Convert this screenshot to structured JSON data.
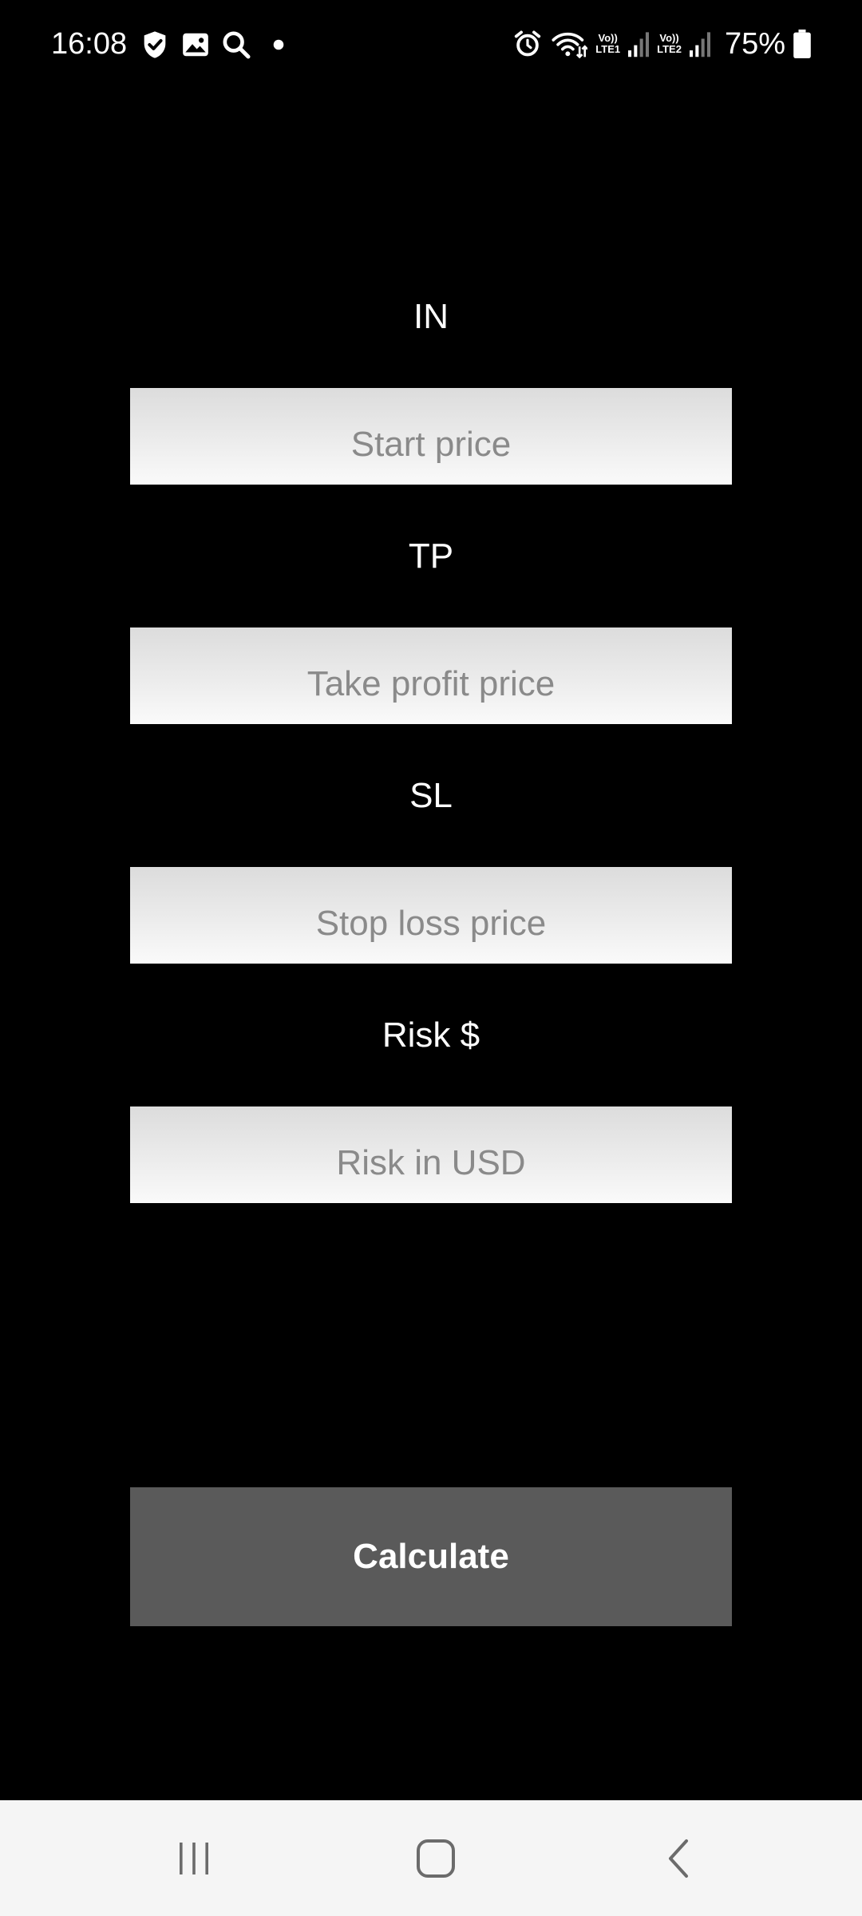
{
  "status_bar": {
    "time": "16:08",
    "left_icons": [
      "shield-check-icon",
      "gallery-icon",
      "search-icon",
      "dot-icon"
    ],
    "right_icons": [
      "alarm-icon",
      "wifi-icon",
      "signal-sim1-icon",
      "signal-sim2-icon",
      "battery-icon"
    ],
    "sim1_tag_top": "Vo))",
    "sim1_tag_bottom": "LTE1",
    "sim2_tag_top": "Vo))",
    "sim2_tag_bottom": "LTE2",
    "battery_percent": "75%"
  },
  "form": {
    "fields": [
      {
        "label": "IN",
        "placeholder": "Start price",
        "value": ""
      },
      {
        "label": "TP",
        "placeholder": "Take profit price",
        "value": ""
      },
      {
        "label": "SL",
        "placeholder": "Stop loss price",
        "value": ""
      },
      {
        "label": "Risk $",
        "placeholder": "Risk in USD",
        "value": ""
      }
    ],
    "calculate_label": "Calculate"
  },
  "nav_bar": {
    "buttons": [
      "recents-icon",
      "home-icon",
      "back-icon"
    ]
  },
  "colors": {
    "background": "#000000",
    "text": "#ffffff",
    "placeholder": "#8a8a8a",
    "button": "#5a5a5a",
    "nav_bar": "#f5f5f5",
    "nav_icon": "#6b6b6b"
  }
}
